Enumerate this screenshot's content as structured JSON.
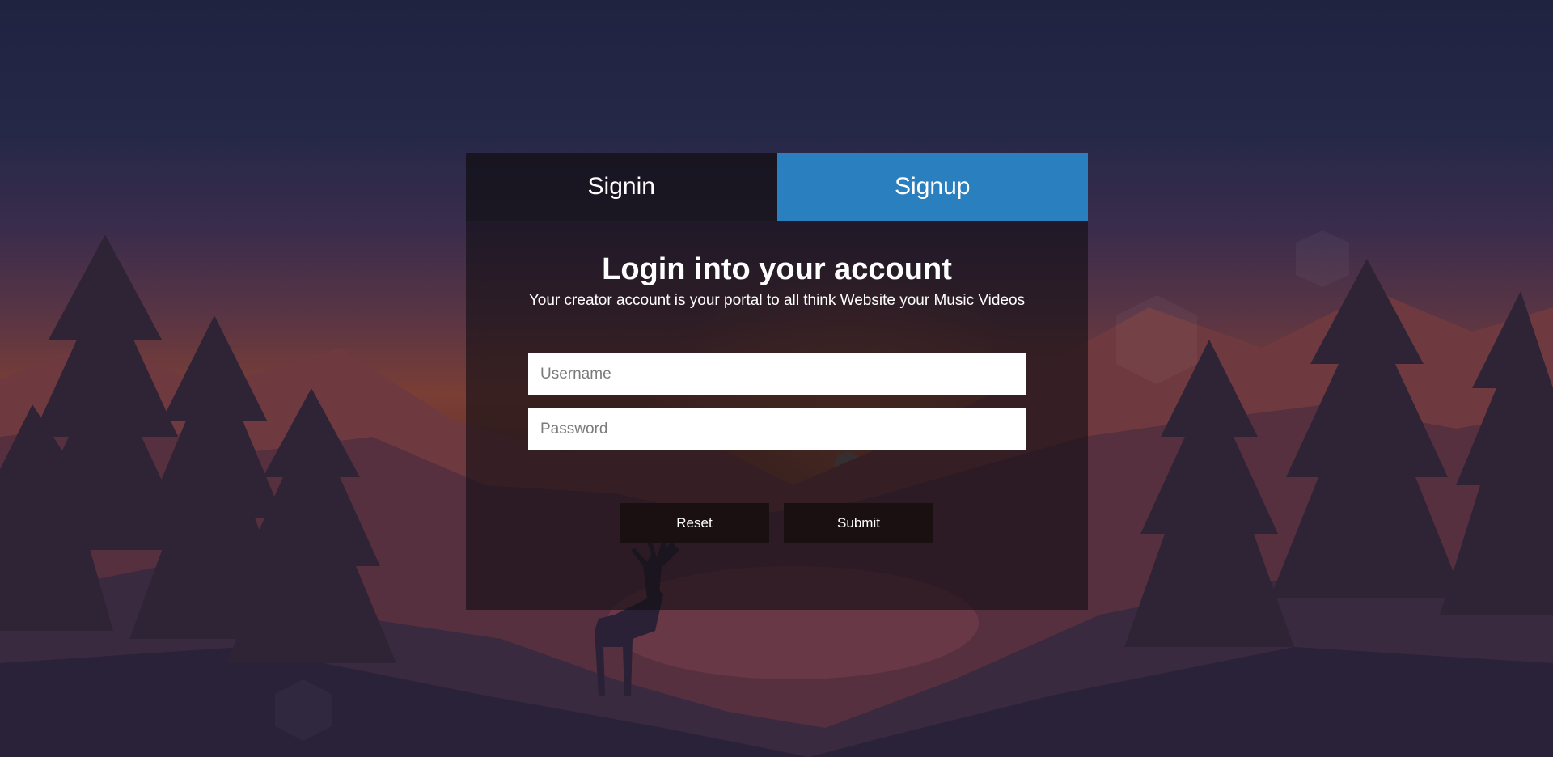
{
  "tabs": {
    "signin_label": "Signin",
    "signup_label": "Signup"
  },
  "form": {
    "heading": "Login into your account",
    "subheading": "Your creator account is your portal to all think Website your Music Videos",
    "username_placeholder": "Username",
    "password_placeholder": "Password",
    "reset_label": "Reset",
    "submit_label": "Submit"
  },
  "colors": {
    "signup_tab": "#2a7fbf",
    "panel": "#120e14",
    "button": "#1a1012"
  }
}
